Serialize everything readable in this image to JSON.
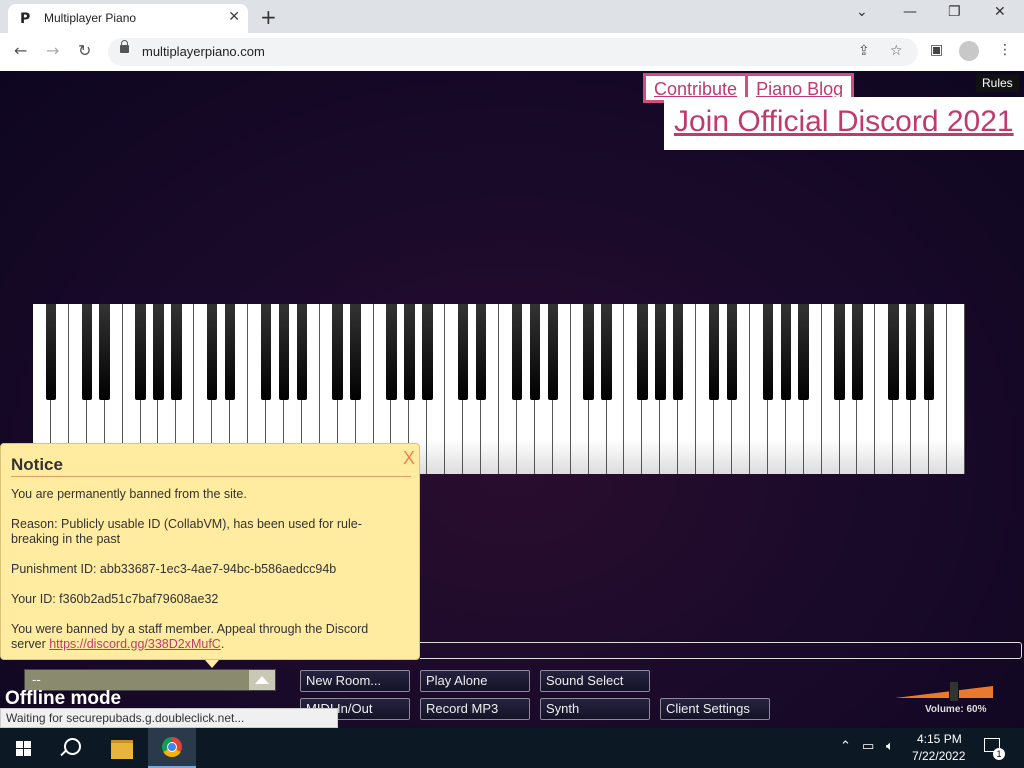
{
  "browser": {
    "tab_title": "Multiplayer Piano",
    "tab_favicon": "P",
    "url": "multiplayerpiano.com",
    "status_text": "Waiting for securepubads.g.doubleclick.net..."
  },
  "header": {
    "contribute_label": "Contribute",
    "piano_blog_label": "Piano Blog",
    "rules_label": "Rules",
    "discord_label": "Join Official Discord 2021"
  },
  "piano": {
    "white_keys": 52,
    "black_keys": 36
  },
  "notice": {
    "title": "Notice",
    "close_label": "X",
    "line1": "You are permanently banned from the site.",
    "reason": "Reason: Publicly usable ID (CollabVM), has been used for rule-breaking in the past",
    "punishment_id": "Punishment ID: abb33687-1ec3-4ae7-94bc-b586aedcc94b",
    "your_id": "Your ID: f360b2ad51c7baf79608ae32",
    "appeal_text": "You were banned by a staff member. Appeal through the Discord server ",
    "appeal_link": "https://discord.gg/338D2xMufC",
    "appeal_end": "."
  },
  "controls": {
    "room_value": "--",
    "offline_label": "Offline mode",
    "new_room": "New Room...",
    "play_alone": "Play Alone",
    "sound_select": "Sound Select",
    "midi": "MIDI In/Out",
    "record_mp3": "Record MP3",
    "synth": "Synth",
    "client_settings": "Client Settings",
    "volume_label": "Volume: 60%",
    "volume_level": 0.6
  },
  "taskbar": {
    "time": "4:15 PM",
    "date": "7/22/2022",
    "notification_count": "1"
  },
  "colors": {
    "accent_pink": "#c03a6d",
    "notice_bg": "#ffeca0",
    "page_bg": "#1a0c2a"
  }
}
